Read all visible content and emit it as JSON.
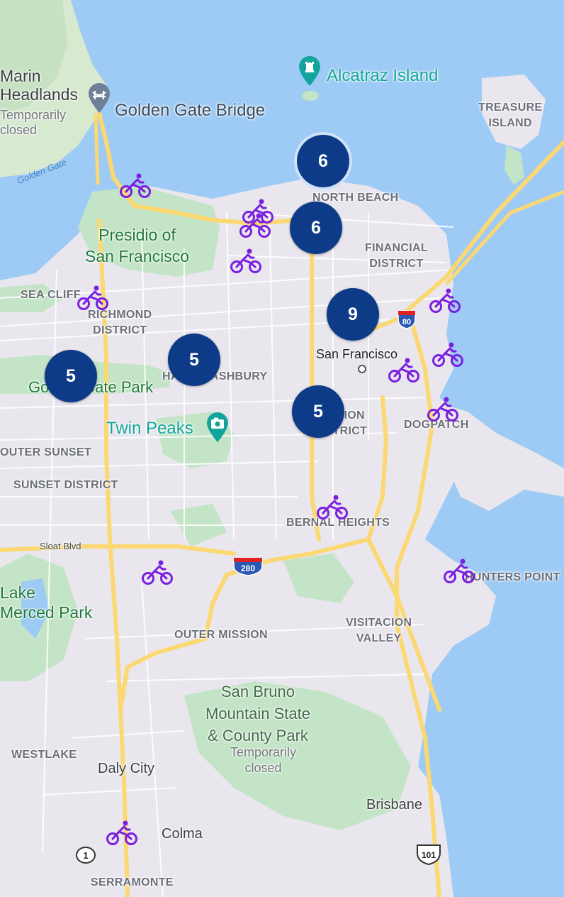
{
  "map": {
    "labels": {
      "marin_headlands": "Marin\nHeadlands",
      "marin_status": "Temporarily\nclosed",
      "golden_gate_bridge": "Golden Gate Bridge",
      "alcatraz": "Alcatraz Island",
      "treasure_island": "TREASURE\nISLAND",
      "golden_gate_water": "Golden Gate",
      "north_beach": "NORTH BEACH",
      "presidio": "Presidio of\nSan Francisco",
      "financial_district": "FINANCIAL\nDISTRICT",
      "sea_cliff": "SEA CLIFF",
      "richmond": "RICHMOND\nDISTRICT",
      "san_francisco": "San Francisco",
      "golden_gate_park": "Golden Gate Park",
      "haight_ashbury": "HAIGHT-ASHBURY",
      "mission_district": "MISSION\nDISTRICT",
      "dogpatch": "DOGPATCH",
      "twin_peaks": "Twin Peaks",
      "outer_sunset": "OUTER SUNSET",
      "sunset_district": "SUNSET DISTRICT",
      "bernal_heights": "BERNAL HEIGHTS",
      "sloat_blvd": "Sloat Blvd",
      "hunters_point": "HUNTERS POINT",
      "lake_merced": "Lake\nMerced Park",
      "outer_mission": "OUTER MISSION",
      "visitacion_valley": "VISITACION\nVALLEY",
      "san_bruno": "San Bruno\nMountain State\n& County Park",
      "san_bruno_status": "Temporarily\nclosed",
      "westlake": "WESTLAKE",
      "daly_city": "Daly City",
      "brisbane": "Brisbane",
      "colma": "Colma",
      "serramonte": "SERRAMONTE"
    },
    "highway_shields": {
      "i80": "80",
      "i280": "280",
      "us101": "101",
      "ca1": "1"
    },
    "clusters": [
      "6",
      "6",
      "9",
      "5",
      "5",
      "5"
    ],
    "bike_markers": 13,
    "colors": {
      "cluster": "#0d3b88",
      "bike_marker": "#7a1fe0",
      "water": "#9dcbf5",
      "land": "#e9e6ee",
      "park": "#c3e4c6",
      "highway": "#fbd872"
    },
    "icons": [
      "bridge-icon",
      "landmark-tower-icon",
      "camera-icon",
      "bicycle-icon"
    ]
  }
}
